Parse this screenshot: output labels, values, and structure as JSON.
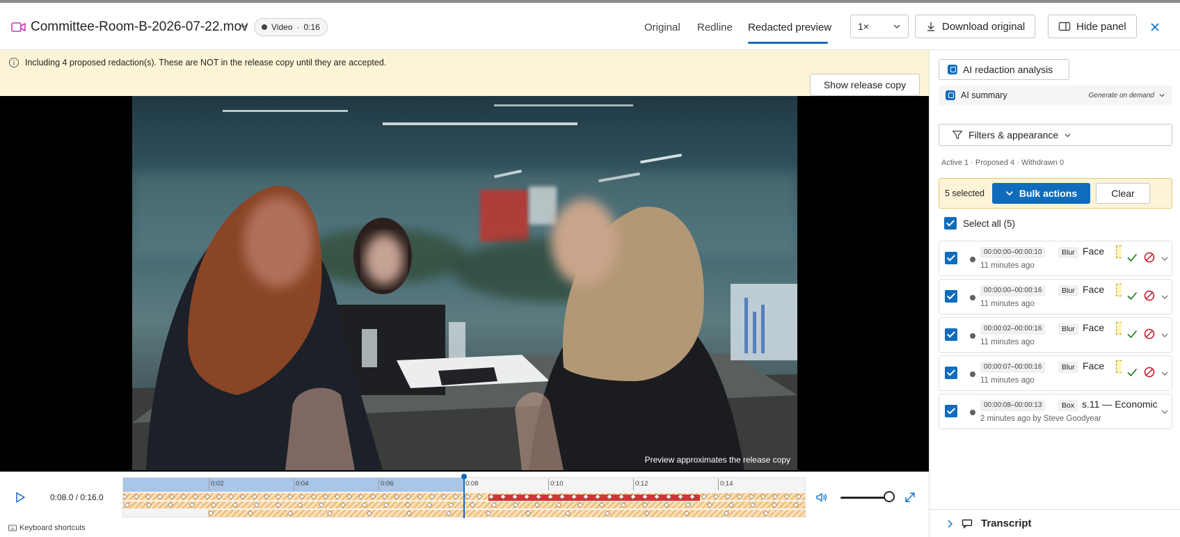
{
  "header": {
    "file_name": "Committee-Room-B-2026-07-22.mov",
    "media_type": "Video",
    "duration": "0:16",
    "tabs": [
      {
        "label": "Original"
      },
      {
        "label": "Redline"
      },
      {
        "label": "Redacted preview"
      }
    ],
    "speed": "1×",
    "download_label": "Download original",
    "hide_panel_label": "Hide panel"
  },
  "notice": {
    "text": "Including 4 proposed redaction(s). These are NOT in the release copy until they are accepted.",
    "release_button": "Show release copy"
  },
  "video": {
    "caption": "Preview approximates the release copy"
  },
  "player": {
    "time": "0:08.0 / 0:16.0",
    "ticks": [
      "0:02",
      "0:04",
      "0:06",
      "0:08",
      "0:10",
      "0:12",
      "0:14"
    ],
    "progress": 0.5,
    "volume": 1.0,
    "keyboard_shortcuts": "Keyboard shortcuts"
  },
  "panel": {
    "ai_analysis_label": "AI redaction analysis",
    "ai_summary_label": "AI summary",
    "ai_summary_action": "Generate on demand",
    "filters_label": "Filters & appearance",
    "status_counts": "Active 1 · Proposed 4 · Withdrawn 0",
    "selected_count": "5 selected",
    "bulk_actions_label": "Bulk actions",
    "clear_label": "Clear",
    "select_all_label": "Select all (5)",
    "redactions": [
      {
        "time": "00:00:00–00:00:10",
        "kind": "Blur",
        "label": "Face",
        "ago": "11 minutes ago",
        "proposed": true
      },
      {
        "time": "00:00:00–00:00:16",
        "kind": "Blur",
        "label": "Face",
        "ago": "11 minutes ago",
        "proposed": true
      },
      {
        "time": "00:00:02–00:00:16",
        "kind": "Blur",
        "label": "Face",
        "ago": "11 minutes ago",
        "proposed": true
      },
      {
        "time": "00:00:07–00:00:16",
        "kind": "Blur",
        "label": "Face",
        "ago": "11 minutes ago",
        "proposed": true
      },
      {
        "time": "00:00:08–00:00:13",
        "kind": "Box",
        "label": "s.11 — Economic",
        "ago": "2 minutes ago by Steve Goodyear",
        "proposed": false
      }
    ],
    "transcript_label": "Transcript"
  },
  "colors": {
    "accent": "#0f6cbd",
    "notice_bg": "#fcf4d6",
    "redaction_red": "#d13438",
    "proposed_track": "#f2c27f",
    "file_icon": "#c239b3",
    "accept_green": "#107c10",
    "reject_red": "#c50f1f"
  }
}
